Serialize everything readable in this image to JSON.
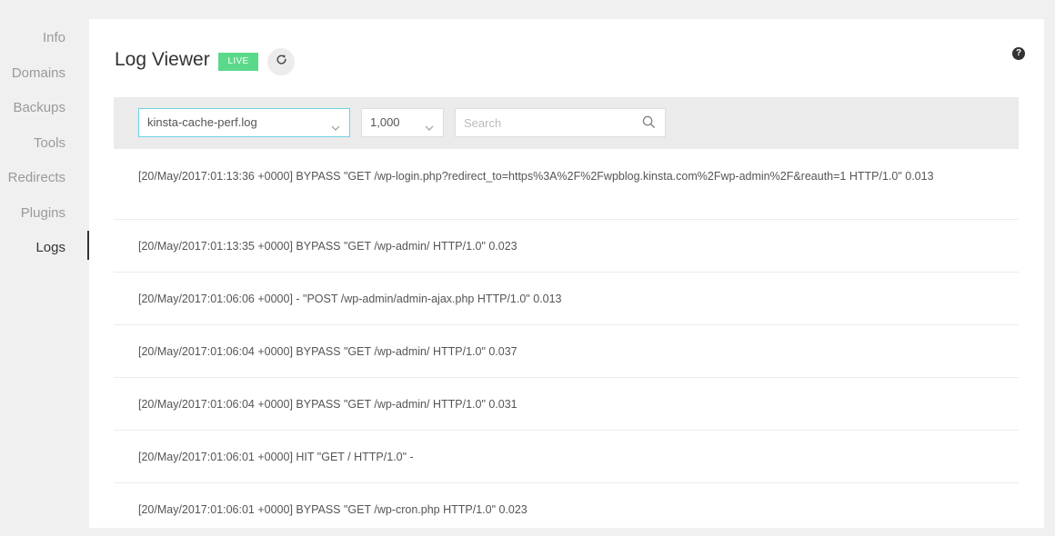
{
  "sidebar": {
    "items": [
      {
        "label": "Info",
        "active": false
      },
      {
        "label": "Domains",
        "active": false
      },
      {
        "label": "Backups",
        "active": false
      },
      {
        "label": "Tools",
        "active": false
      },
      {
        "label": "Redirects",
        "active": false
      },
      {
        "label": "Plugins",
        "active": false
      },
      {
        "label": "Logs",
        "active": true
      }
    ]
  },
  "header": {
    "title": "Log Viewer",
    "badge": "LIVE",
    "help": "?"
  },
  "toolbar": {
    "file_select": "kinsta-cache-perf.log",
    "count_select": "1,000",
    "search_placeholder": "Search",
    "search_value": ""
  },
  "logs": [
    "[20/May/2017:01:13:36 +0000] BYPASS \"GET /wp-login.php?redirect_to=https%3A%2F%2Fwpblog.kinsta.com%2Fwp-admin%2F&reauth=1 HTTP/1.0\" 0.013",
    "[20/May/2017:01:13:35 +0000] BYPASS \"GET /wp-admin/ HTTP/1.0\" 0.023",
    "[20/May/2017:01:06:06 +0000] - \"POST /wp-admin/admin-ajax.php HTTP/1.0\" 0.013",
    "[20/May/2017:01:06:04 +0000] BYPASS \"GET /wp-admin/ HTTP/1.0\" 0.037",
    "[20/May/2017:01:06:04 +0000] BYPASS \"GET /wp-admin/ HTTP/1.0\" 0.031",
    "[20/May/2017:01:06:01 +0000] HIT \"GET / HTTP/1.0\" -",
    "[20/May/2017:01:06:01 +0000] BYPASS \"GET /wp-cron.php HTTP/1.0\" 0.023"
  ],
  "colors": {
    "accent_live": "#5bd98a",
    "select_focus_border": "#6ed3e2",
    "page_bg": "#f0f0f0",
    "panel_bg": "#ffffff"
  },
  "icons": [
    "refresh-icon",
    "help-icon",
    "chevron-down-icon",
    "search-icon"
  ]
}
